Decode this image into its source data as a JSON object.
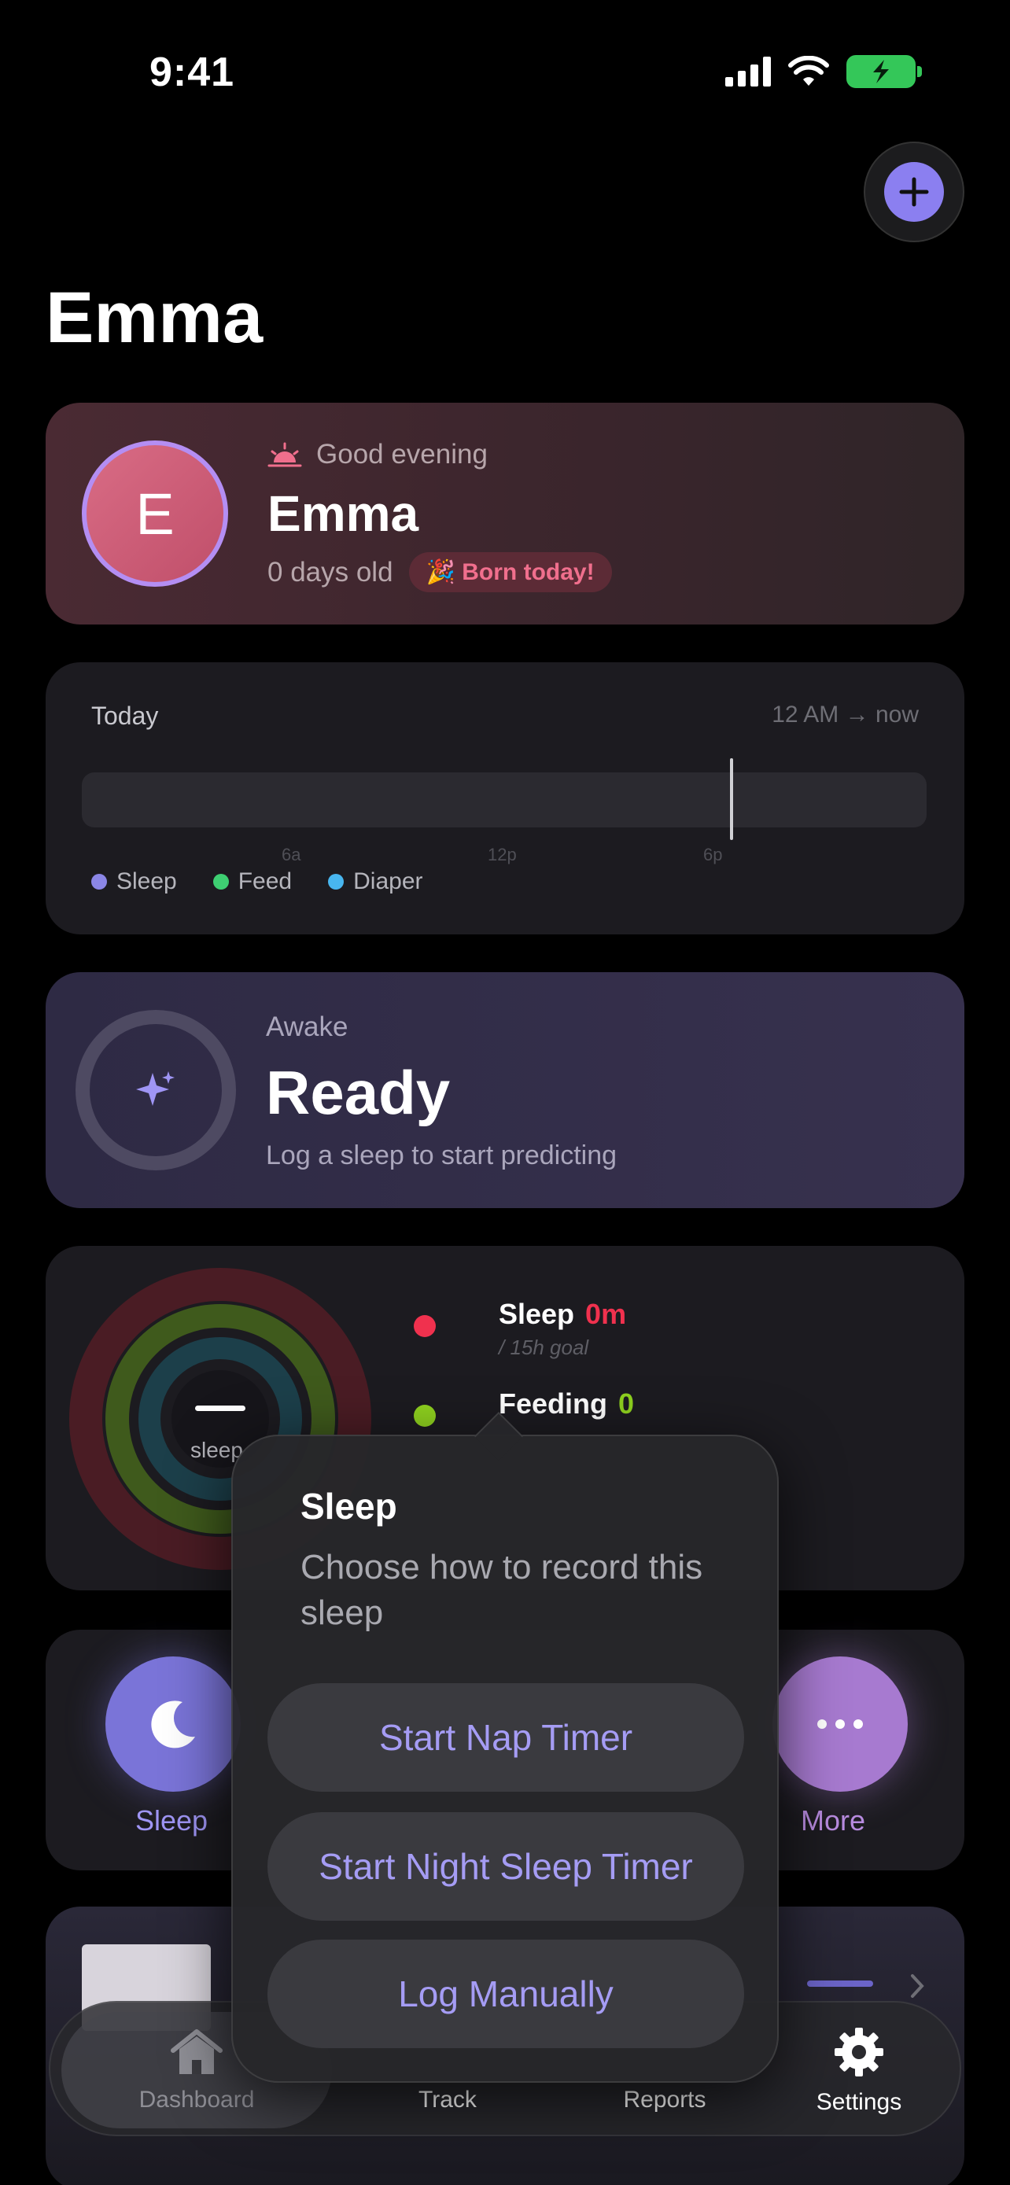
{
  "status_bar": {
    "time": "9:41"
  },
  "header": {
    "title": "Emma"
  },
  "profile": {
    "initial": "E",
    "greeting": "Good evening",
    "name": "Emma",
    "age": "0 days old",
    "badge": "🎉 Born today!"
  },
  "today": {
    "label": "Today",
    "range": "12 AM → now",
    "ticks": [
      "6a",
      "12p",
      "6p"
    ],
    "legend": [
      {
        "label": "Sleep",
        "color": "#8b86e6"
      },
      {
        "label": "Feed",
        "color": "#3ecf72"
      },
      {
        "label": "Diaper",
        "color": "#48b6ef"
      }
    ]
  },
  "prediction": {
    "state": "Awake",
    "headline": "Ready",
    "hint": "Log a sleep to start predicting"
  },
  "rings": {
    "center_label": "sleep",
    "metrics": [
      {
        "name": "Sleep",
        "value": "0m",
        "goal": "/ 15h goal",
        "color": "#f0314e"
      },
      {
        "name": "Feeding",
        "value": "0",
        "color": "#8fd21f"
      }
    ]
  },
  "quick_actions": [
    {
      "label": "Sleep",
      "icon": "moon-icon",
      "color": "#7a74d8"
    },
    {
      "label": "More",
      "icon": "ellipsis-icon",
      "color": "#a77ad0"
    }
  ],
  "popover": {
    "title": "Sleep",
    "description": "Choose how to record this sleep",
    "buttons": [
      "Start Nap Timer",
      "Start Night Sleep Timer",
      "Log Manually"
    ]
  },
  "tabbar": {
    "tabs": [
      {
        "label": "Dashboard",
        "icon": "house-icon",
        "active": true
      },
      {
        "label": "Track",
        "icon": "track-icon",
        "active": false
      },
      {
        "label": "Reports",
        "icon": "reports-icon",
        "active": false
      },
      {
        "label": "Settings",
        "icon": "gear-icon",
        "active": false
      }
    ]
  }
}
